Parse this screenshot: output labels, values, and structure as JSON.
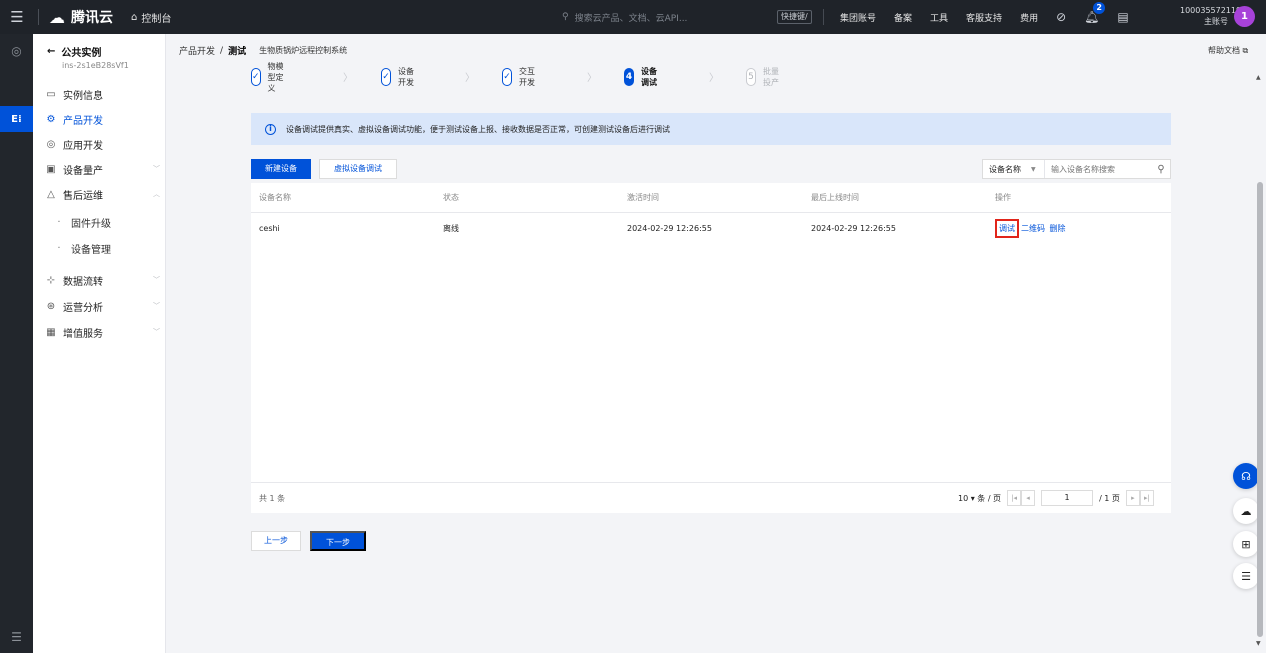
{
  "topbar": {
    "brand": "腾讯云",
    "console": "控制台",
    "search_placeholder": "搜索云产品、文档、云API...",
    "shortcut": "快捷键/",
    "links": [
      "集团账号",
      "备案",
      "工具",
      "客服支持",
      "费用"
    ],
    "notification_count": "2",
    "account_id": "100035572119",
    "account_role": "主账号",
    "avatar": "1"
  },
  "sidebar": {
    "back_label": "公共实例",
    "instance_id": "ins-2s1eB28sVf1",
    "items": [
      {
        "label": "实例信息",
        "icon": "monitor-icon"
      },
      {
        "label": "产品开发",
        "icon": "gear-icon",
        "active": true
      },
      {
        "label": "应用开发",
        "icon": "app-icon"
      },
      {
        "label": "设备量产",
        "icon": "chip-icon"
      },
      {
        "label": "售后运维",
        "icon": "triangle-icon"
      },
      {
        "label": "固件升级"
      },
      {
        "label": "设备管理"
      },
      {
        "label": "数据流转",
        "icon": "flow-icon"
      },
      {
        "label": "运营分析",
        "icon": "chart-icon"
      },
      {
        "label": "增值服务",
        "icon": "service-icon"
      }
    ]
  },
  "breadcrumb": {
    "root": "产品开发",
    "sep": "/",
    "current": "测试",
    "project": "生物质锅炉远程控制系统"
  },
  "help": "帮助文档 ⧉",
  "steps": [
    {
      "num": "✓",
      "label": "物模型定义",
      "state": "done"
    },
    {
      "num": "✓",
      "label": "设备开发",
      "state": "done"
    },
    {
      "num": "✓",
      "label": "交互开发",
      "state": "done"
    },
    {
      "num": "4",
      "label": "设备调试",
      "state": "current"
    },
    {
      "num": "5",
      "label": "批量投产",
      "state": "todo"
    }
  ],
  "notice": "设备调试提供真实、虚拟设备调试功能，便于测试设备上报、接收数据是否正常，可创建测试设备后进行调试",
  "toolbar": {
    "new_device": "新建设备",
    "virtual_debug": "虚拟设备调试",
    "filter_field": "设备名称",
    "filter_placeholder": "输入设备名称搜索"
  },
  "table": {
    "headers": [
      "设备名称",
      "状态",
      "激活时间",
      "最后上线时间",
      "操作"
    ],
    "rows": [
      {
        "name": "ceshi",
        "status": "离线",
        "activated": "2024-02-29 12:26:55",
        "last_online": "2024-02-29 12:26:55",
        "actions": [
          "调试",
          "二维码",
          "删除"
        ]
      }
    ]
  },
  "pagination": {
    "total": "共 1 条",
    "page_size": "10 ▾ 条 / 页",
    "page": "1",
    "page_of": "/ 1 页"
  },
  "nav": {
    "prev": "上一步",
    "next": "下一步"
  },
  "colors": {
    "primary": "#0052d9",
    "highlight": "#e1251b",
    "topbar": "#1f2329"
  }
}
